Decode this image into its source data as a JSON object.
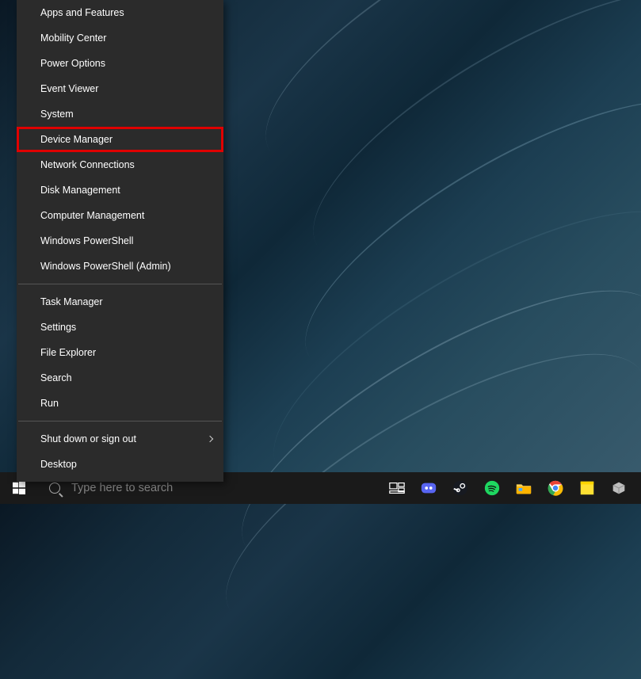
{
  "menu": {
    "groups": [
      [
        {
          "label": "Apps and Features",
          "highlighted": false
        },
        {
          "label": "Mobility Center",
          "highlighted": false
        },
        {
          "label": "Power Options",
          "highlighted": false
        },
        {
          "label": "Event Viewer",
          "highlighted": false
        },
        {
          "label": "System",
          "highlighted": false
        },
        {
          "label": "Device Manager",
          "highlighted": true
        },
        {
          "label": "Network Connections",
          "highlighted": false
        },
        {
          "label": "Disk Management",
          "highlighted": false
        },
        {
          "label": "Computer Management",
          "highlighted": false
        },
        {
          "label": "Windows PowerShell",
          "highlighted": false
        },
        {
          "label": "Windows PowerShell (Admin)",
          "highlighted": false
        }
      ],
      [
        {
          "label": "Task Manager",
          "highlighted": false
        },
        {
          "label": "Settings",
          "highlighted": false
        },
        {
          "label": "File Explorer",
          "highlighted": false
        },
        {
          "label": "Search",
          "highlighted": false
        },
        {
          "label": "Run",
          "highlighted": false
        }
      ],
      [
        {
          "label": "Shut down or sign out",
          "highlighted": false,
          "submenu": true
        },
        {
          "label": "Desktop",
          "highlighted": false
        }
      ]
    ]
  },
  "highlight_color": "#e00000",
  "taskbar": {
    "search_placeholder": "Type here to search",
    "icons": [
      {
        "name": "task-view-icon"
      },
      {
        "name": "discord-icon",
        "bg": "#5865f2",
        "glyph": "discord"
      },
      {
        "name": "steam-icon",
        "bg": "#ffffff",
        "glyph": "steam"
      },
      {
        "name": "spotify-icon",
        "bg": "#1ed760",
        "glyph": "spotify"
      },
      {
        "name": "file-explorer-icon",
        "glyph": "folder"
      },
      {
        "name": "chrome-icon",
        "glyph": "chrome"
      },
      {
        "name": "note-icon",
        "bg": "#ffdd00",
        "glyph": "note"
      },
      {
        "name": "app-icon",
        "glyph": "box"
      }
    ]
  }
}
